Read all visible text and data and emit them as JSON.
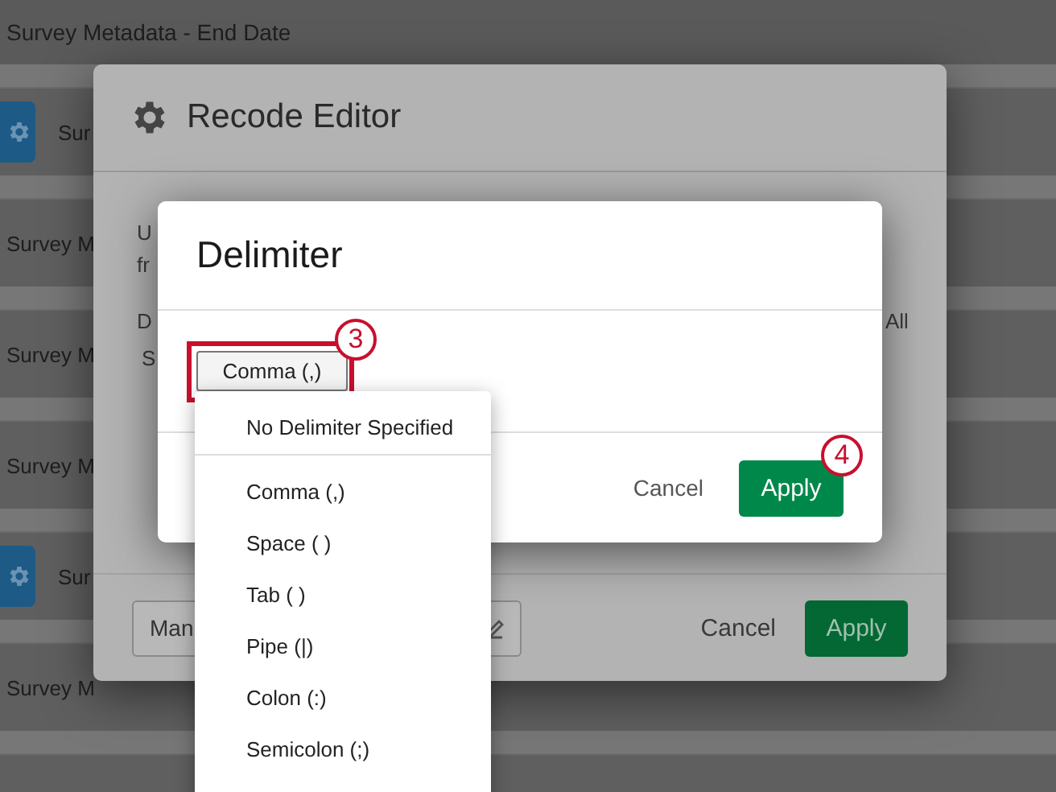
{
  "background_list": {
    "rows": [
      {
        "label": "Survey Metadata - End Date",
        "kind": "header"
      },
      {
        "label": "Sur",
        "kind": "gear"
      },
      {
        "label": "Survey M",
        "kind": "plain"
      },
      {
        "label": "Survey M",
        "kind": "plain"
      },
      {
        "label": "Survey M",
        "kind": "plain"
      },
      {
        "label": "Sur",
        "kind": "gear"
      },
      {
        "label": "Survey M",
        "kind": "plain"
      },
      {
        "kind": "blank"
      }
    ]
  },
  "recode_editor": {
    "title": "Recode Editor",
    "body_texts": [
      "U",
      "fr",
      "D",
      "S",
      "All"
    ],
    "manage_button": "Man",
    "cancel": "Cancel",
    "apply": "Apply"
  },
  "delimiter_dialog": {
    "title": "Delimiter",
    "select": {
      "value": "Comma (,)",
      "expanded": true
    },
    "cancel": "Cancel",
    "apply": "Apply",
    "callouts": [
      "3",
      "4"
    ]
  },
  "dropdown": {
    "items": [
      {
        "label": "No Delimiter Specified",
        "kind": "none"
      },
      {
        "label": "Comma (,)",
        "kind": "option"
      },
      {
        "label": "Space ( )",
        "kind": "option"
      },
      {
        "label": "Tab ( )",
        "kind": "option"
      },
      {
        "label": "Pipe (|)",
        "kind": "option"
      },
      {
        "label": "Colon (:)",
        "kind": "option"
      },
      {
        "label": "Semicolon (;)",
        "kind": "option"
      }
    ]
  }
}
